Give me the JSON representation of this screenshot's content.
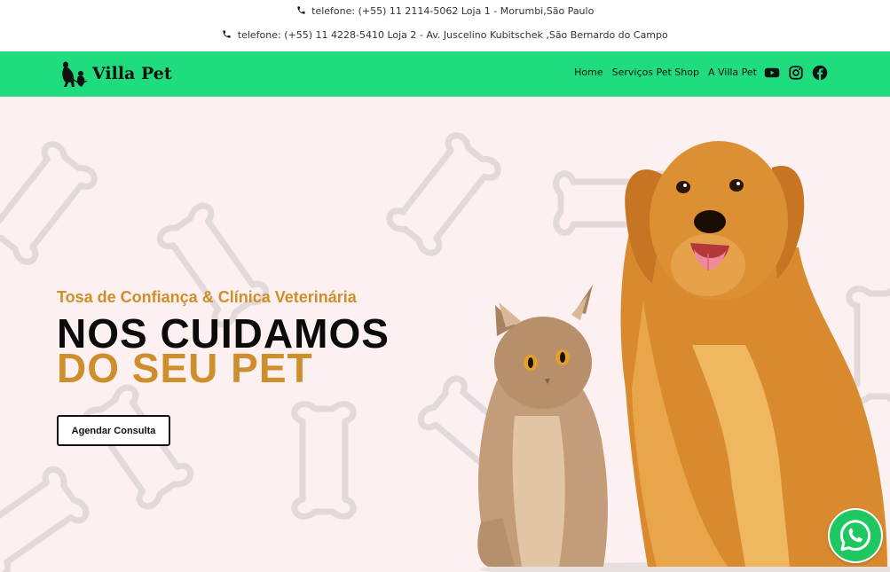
{
  "contact": {
    "lines": [
      "telefone: (+55) 11 2114-5062 Loja 1 - Morumbi,São Paulo",
      "telefone: (+55) 11 4228-5410 Loja 2 - Av. Juscelino Kubitschek ,São Bernardo do Campo"
    ]
  },
  "navbar": {
    "brand": "Villa Pet",
    "links": [
      "Home",
      "Serviços Pet Shop",
      "A Villa Pet"
    ],
    "social": [
      "youtube-icon",
      "instagram-icon",
      "facebook-icon"
    ],
    "background": "#1fdd7e"
  },
  "hero": {
    "subtitle": "Tosa de Confiança & Clínica Veterinária",
    "headline_line1": "NOS CUIDAMOS",
    "headline_line2": "DO SEU PET",
    "cta_label": "Agendar Consulta",
    "background": "#fdf0f0",
    "accent": "#cf8e2c"
  },
  "floating": {
    "whatsapp_icon": "whatsapp-icon",
    "color": "#1fc761"
  }
}
